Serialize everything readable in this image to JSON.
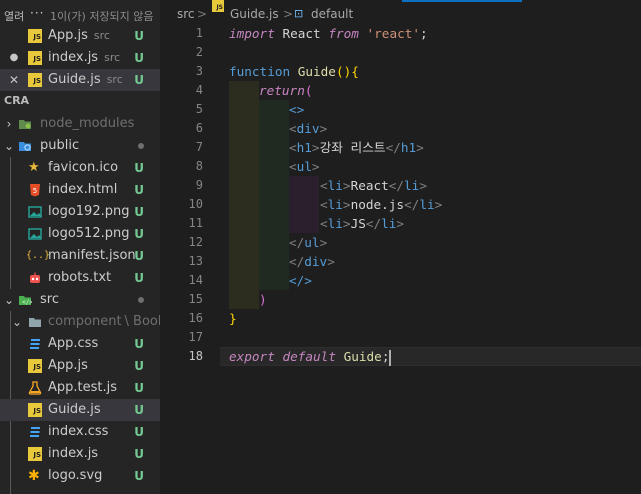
{
  "sidebar": {
    "title": "열려",
    "more": "···",
    "unsaved": "1이(가) 저장되지 않음",
    "open_editors": [
      {
        "name": "App.js",
        "dir": "src",
        "status": "U",
        "lead": ""
      },
      {
        "name": "index.js",
        "dir": "src",
        "status": "U",
        "lead": "●"
      },
      {
        "name": "Guide.js",
        "dir": "src",
        "status": "U",
        "lead": "✕"
      }
    ],
    "section": "CRA",
    "tree": [
      {
        "name": "node_modules",
        "status": ""
      },
      {
        "name": "public",
        "status": ""
      },
      {
        "name": "favicon.ico",
        "status": "U"
      },
      {
        "name": "index.html",
        "status": "U"
      },
      {
        "name": "logo192.png",
        "status": "U"
      },
      {
        "name": "logo512.png",
        "status": "U"
      },
      {
        "name": "manifest.json",
        "status": "U"
      },
      {
        "name": "robots.txt",
        "status": "U"
      },
      {
        "name": "src",
        "status": ""
      },
      {
        "name": "component",
        "sub": "\\ Books",
        "status": ""
      },
      {
        "name": "App.css",
        "status": "U"
      },
      {
        "name": "App.js",
        "status": "U"
      },
      {
        "name": "App.test.js",
        "status": "U"
      },
      {
        "name": "Guide.js",
        "status": "U"
      },
      {
        "name": "index.css",
        "status": "U"
      },
      {
        "name": "index.js",
        "status": "U"
      },
      {
        "name": "logo.svg",
        "status": "U"
      }
    ]
  },
  "breadcrumb": {
    "folder": "src",
    "sep": ">",
    "file": "Guide.js",
    "symbol": "default"
  },
  "editor": {
    "active_line": 18,
    "lines": [
      {
        "n": 1
      },
      {
        "n": 2
      },
      {
        "n": 3
      },
      {
        "n": 4
      },
      {
        "n": 5
      },
      {
        "n": 6
      },
      {
        "n": 7
      },
      {
        "n": 8
      },
      {
        "n": 9
      },
      {
        "n": 10
      },
      {
        "n": 11
      },
      {
        "n": 12
      },
      {
        "n": 13
      },
      {
        "n": 14
      },
      {
        "n": 15
      },
      {
        "n": 16
      },
      {
        "n": 17
      },
      {
        "n": 18
      }
    ],
    "code": {
      "l1": {
        "kw": "import",
        "id": " React ",
        "kw2": "from",
        "str": "'react'",
        "end": ";"
      },
      "l3": {
        "kw": "function",
        "fn": "Guide",
        "open": "(){"
      },
      "l4": {
        "kw": "return",
        "paren": "("
      },
      "l5": {
        "text": "<>"
      },
      "l6": {
        "tag": "div"
      },
      "l7": {
        "tag": "h1",
        "text": "강좌 리스트"
      },
      "l8": {
        "tag": "ul"
      },
      "l9": {
        "tag": "li",
        "text": "React"
      },
      "l10": {
        "tag": "li",
        "text": "node.js"
      },
      "l11": {
        "tag": "li",
        "text": "JS"
      },
      "l12": {
        "tag": "ul"
      },
      "l13": {
        "tag": "div"
      },
      "l14": {
        "text": "</>"
      },
      "l15": {
        "paren": ")"
      },
      "l16": {
        "brace": "}"
      },
      "l18": {
        "kw": "export",
        "kw2": "default",
        "id": "Guide",
        "end": ";"
      }
    }
  },
  "colors": {
    "accent": "#0e70c0",
    "untracked": "#73c991",
    "js_icon": "#e8c93b"
  }
}
